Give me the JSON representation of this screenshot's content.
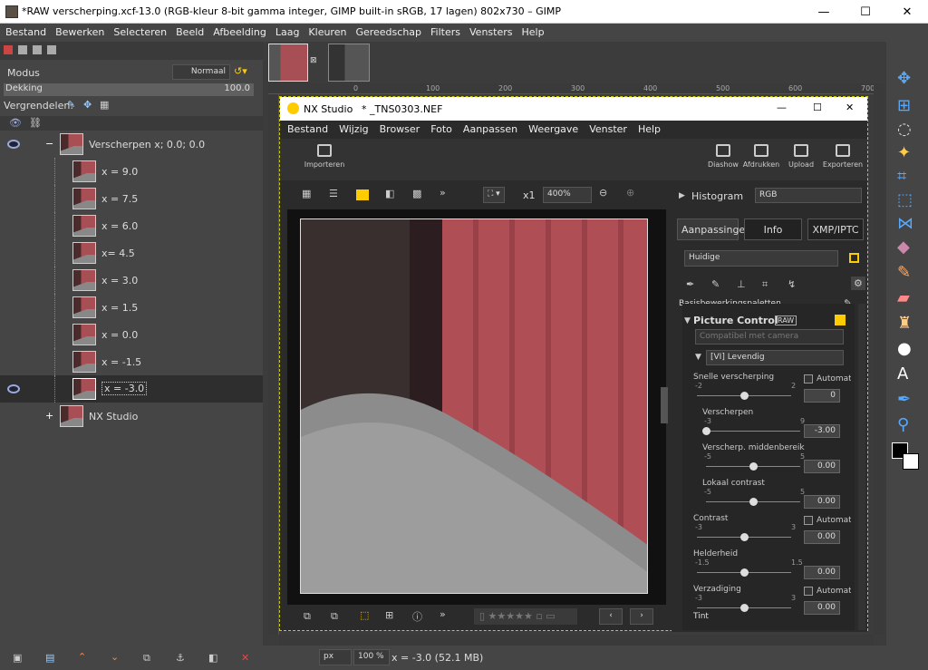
{
  "gimp": {
    "title": "*RAW verscherping.xcf-13.0 (RGB-kleur 8-bit gamma integer, GIMP built-in sRGB, 17 lagen) 802x730 – GIMP",
    "menu": [
      "Bestand",
      "Bewerken",
      "Selecteren",
      "Beeld",
      "Afbeelding",
      "Laag",
      "Kleuren",
      "Gereedschap",
      "Filters",
      "Vensters",
      "Help"
    ],
    "mode_label": "Modus",
    "mode_value": "Normaal",
    "opacity_label": "Dekking",
    "opacity_value": "100.0",
    "lock_label": "Vergrendelen:",
    "layers": [
      {
        "name": "Verscherpen x; 0.0; 0.0"
      },
      {
        "name": "x = 9.0"
      },
      {
        "name": "x = 7.5"
      },
      {
        "name": "x = 6.0"
      },
      {
        "name": "x= 4.5"
      },
      {
        "name": "x = 3.0"
      },
      {
        "name": "x = 1.5"
      },
      {
        "name": "x = 0.0"
      },
      {
        "name": "x = -1.5"
      },
      {
        "name": "x = -3.0"
      },
      {
        "name": "NX Studio"
      }
    ],
    "ruler_ticks": [
      "0",
      "100",
      "200",
      "300",
      "400",
      "500",
      "600",
      "700"
    ],
    "status_unit": "px",
    "status_zoom": "100 %",
    "status_text": "x = -3.0 (52.1 MB)"
  },
  "nx": {
    "app": "NX Studio",
    "file": "* _TNS0303.NEF",
    "menu": [
      "Bestand",
      "Wijzig",
      "Browser",
      "Foto",
      "Aanpassen",
      "Weergave",
      "Venster",
      "Help"
    ],
    "toolbar": {
      "import": "Importeren",
      "slideshow": "Diashow",
      "print": "Afdrukken",
      "upload": "Upload",
      "export": "Exporteren"
    },
    "view": {
      "x1": "x1",
      "zoom": "400%"
    },
    "histogram_label": "Histogram",
    "histogram_value": "RGB",
    "tabs": [
      "Aanpassingen",
      "Info",
      "XMP/IPTC"
    ],
    "preset": "Huidige",
    "section": "Basisbewerkingspaletten",
    "pc_title": "Picture Control",
    "pc_badge": "RAW",
    "compat": "Compatibel met camera",
    "pc_value": "[VI] Levendig",
    "params": [
      {
        "label": "Snelle verscherping",
        "min": "-2",
        "max": "2",
        "value": "0",
        "auto": "Automatisch",
        "pos": 0.5
      },
      {
        "label": "Verscherpen",
        "min": "-3",
        "max": "9",
        "value": "-3.00",
        "pos": 0.0
      },
      {
        "label": "Verscherp. middenbereik",
        "min": "-5",
        "max": "5",
        "value": "0.00",
        "pos": 0.5
      },
      {
        "label": "Lokaal contrast",
        "min": "-5",
        "max": "5",
        "value": "0.00",
        "pos": 0.5
      },
      {
        "label": "Contrast",
        "min": "-3",
        "max": "3",
        "value": "0.00",
        "auto": "Automatisch",
        "pos": 0.5
      },
      {
        "label": "Helderheid",
        "min": "-1.5",
        "max": "1.5",
        "value": "0.00",
        "pos": 0.5
      },
      {
        "label": "Verzadiging",
        "min": "-3",
        "max": "3",
        "value": "0.00",
        "auto": "Automatisch",
        "pos": 0.5
      }
    ],
    "next_label": "Tint"
  }
}
